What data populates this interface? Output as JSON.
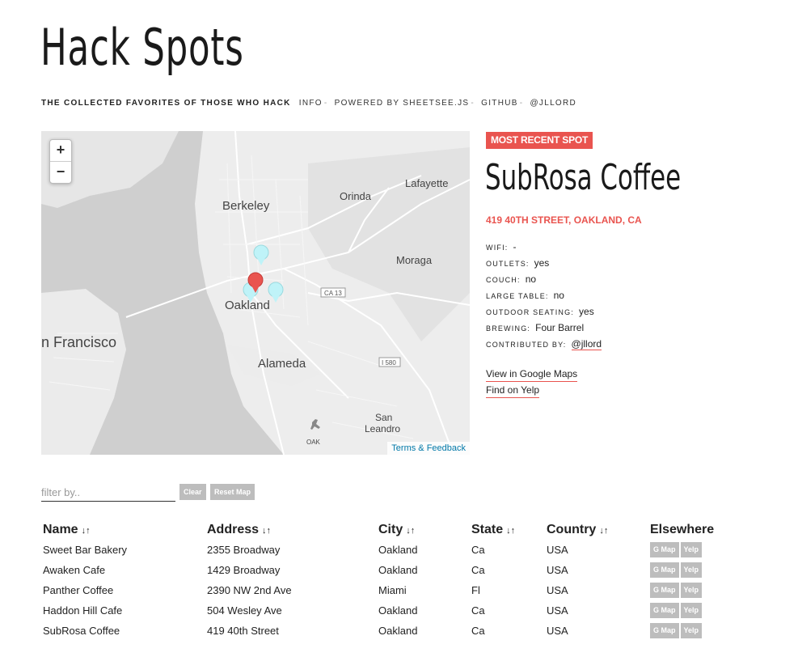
{
  "header": {
    "title": "Hack Spots",
    "tagline": "THE COLLECTED FAVORITES OF THOSE WHO HACK",
    "nav": [
      "INFO",
      "POWERED BY SHEETSEE.JS",
      "GITHUB",
      "@JLLORD"
    ],
    "separator": "-"
  },
  "map": {
    "zoom_in": "+",
    "zoom_out": "−",
    "attribution": "Terms & Feedback",
    "labels": {
      "berkeley": "Berkeley",
      "orinda": "Orinda",
      "lafayette": "Lafayette",
      "moraga": "Moraga",
      "oakland": "Oakland",
      "sf": "n Francisco",
      "alameda": "Alameda",
      "san": "San",
      "leandro": "Leandro",
      "oak": "OAK",
      "ca13": "CA 13",
      "i580": "I 580"
    }
  },
  "recent": {
    "badge": "MOST RECENT SPOT",
    "name": "SubRosa Coffee",
    "address": "419 40TH STREET, OAKLAND, CA",
    "details": [
      {
        "key": "WIFI:",
        "value": "-"
      },
      {
        "key": "OUTLETS:",
        "value": "yes"
      },
      {
        "key": "COUCH:",
        "value": "no"
      },
      {
        "key": "LARGE TABLE:",
        "value": "no"
      },
      {
        "key": "OUTDOOR SEATING:",
        "value": "yes"
      },
      {
        "key": "BREWING:",
        "value": "Four Barrel"
      },
      {
        "key": "CONTRIBUTED BY:",
        "value": "@jllord"
      }
    ],
    "google_maps": "View in Google Maps",
    "yelp": "Find on Yelp"
  },
  "controls": {
    "filter_placeholder": "filter by..",
    "clear": "Clear",
    "reset_map": "Reset Map"
  },
  "table": {
    "sort_icon": "↓↑",
    "columns": [
      "Name",
      "Address",
      "City",
      "State",
      "Country",
      "Elsewhere"
    ],
    "gmap_label": "G Map",
    "yelp_label": "Yelp",
    "rows": [
      [
        "Sweet Bar Bakery",
        "2355 Broadway",
        "Oakland",
        "Ca",
        "USA"
      ],
      [
        "Awaken Cafe",
        "1429 Broadway",
        "Oakland",
        "Ca",
        "USA"
      ],
      [
        "Panther Coffee",
        "2390 NW 2nd Ave",
        "Miami",
        "Fl",
        "USA"
      ],
      [
        "Haddon Hill Cafe",
        "504 Wesley Ave",
        "Oakland",
        "Ca",
        "USA"
      ],
      [
        "SubRosa Coffee",
        "419 40th Street",
        "Oakland",
        "Ca",
        "USA"
      ]
    ]
  },
  "colors": {
    "accent": "#e9544f",
    "marker": "#bff3f8",
    "button_grey": "#bdbdbd"
  }
}
